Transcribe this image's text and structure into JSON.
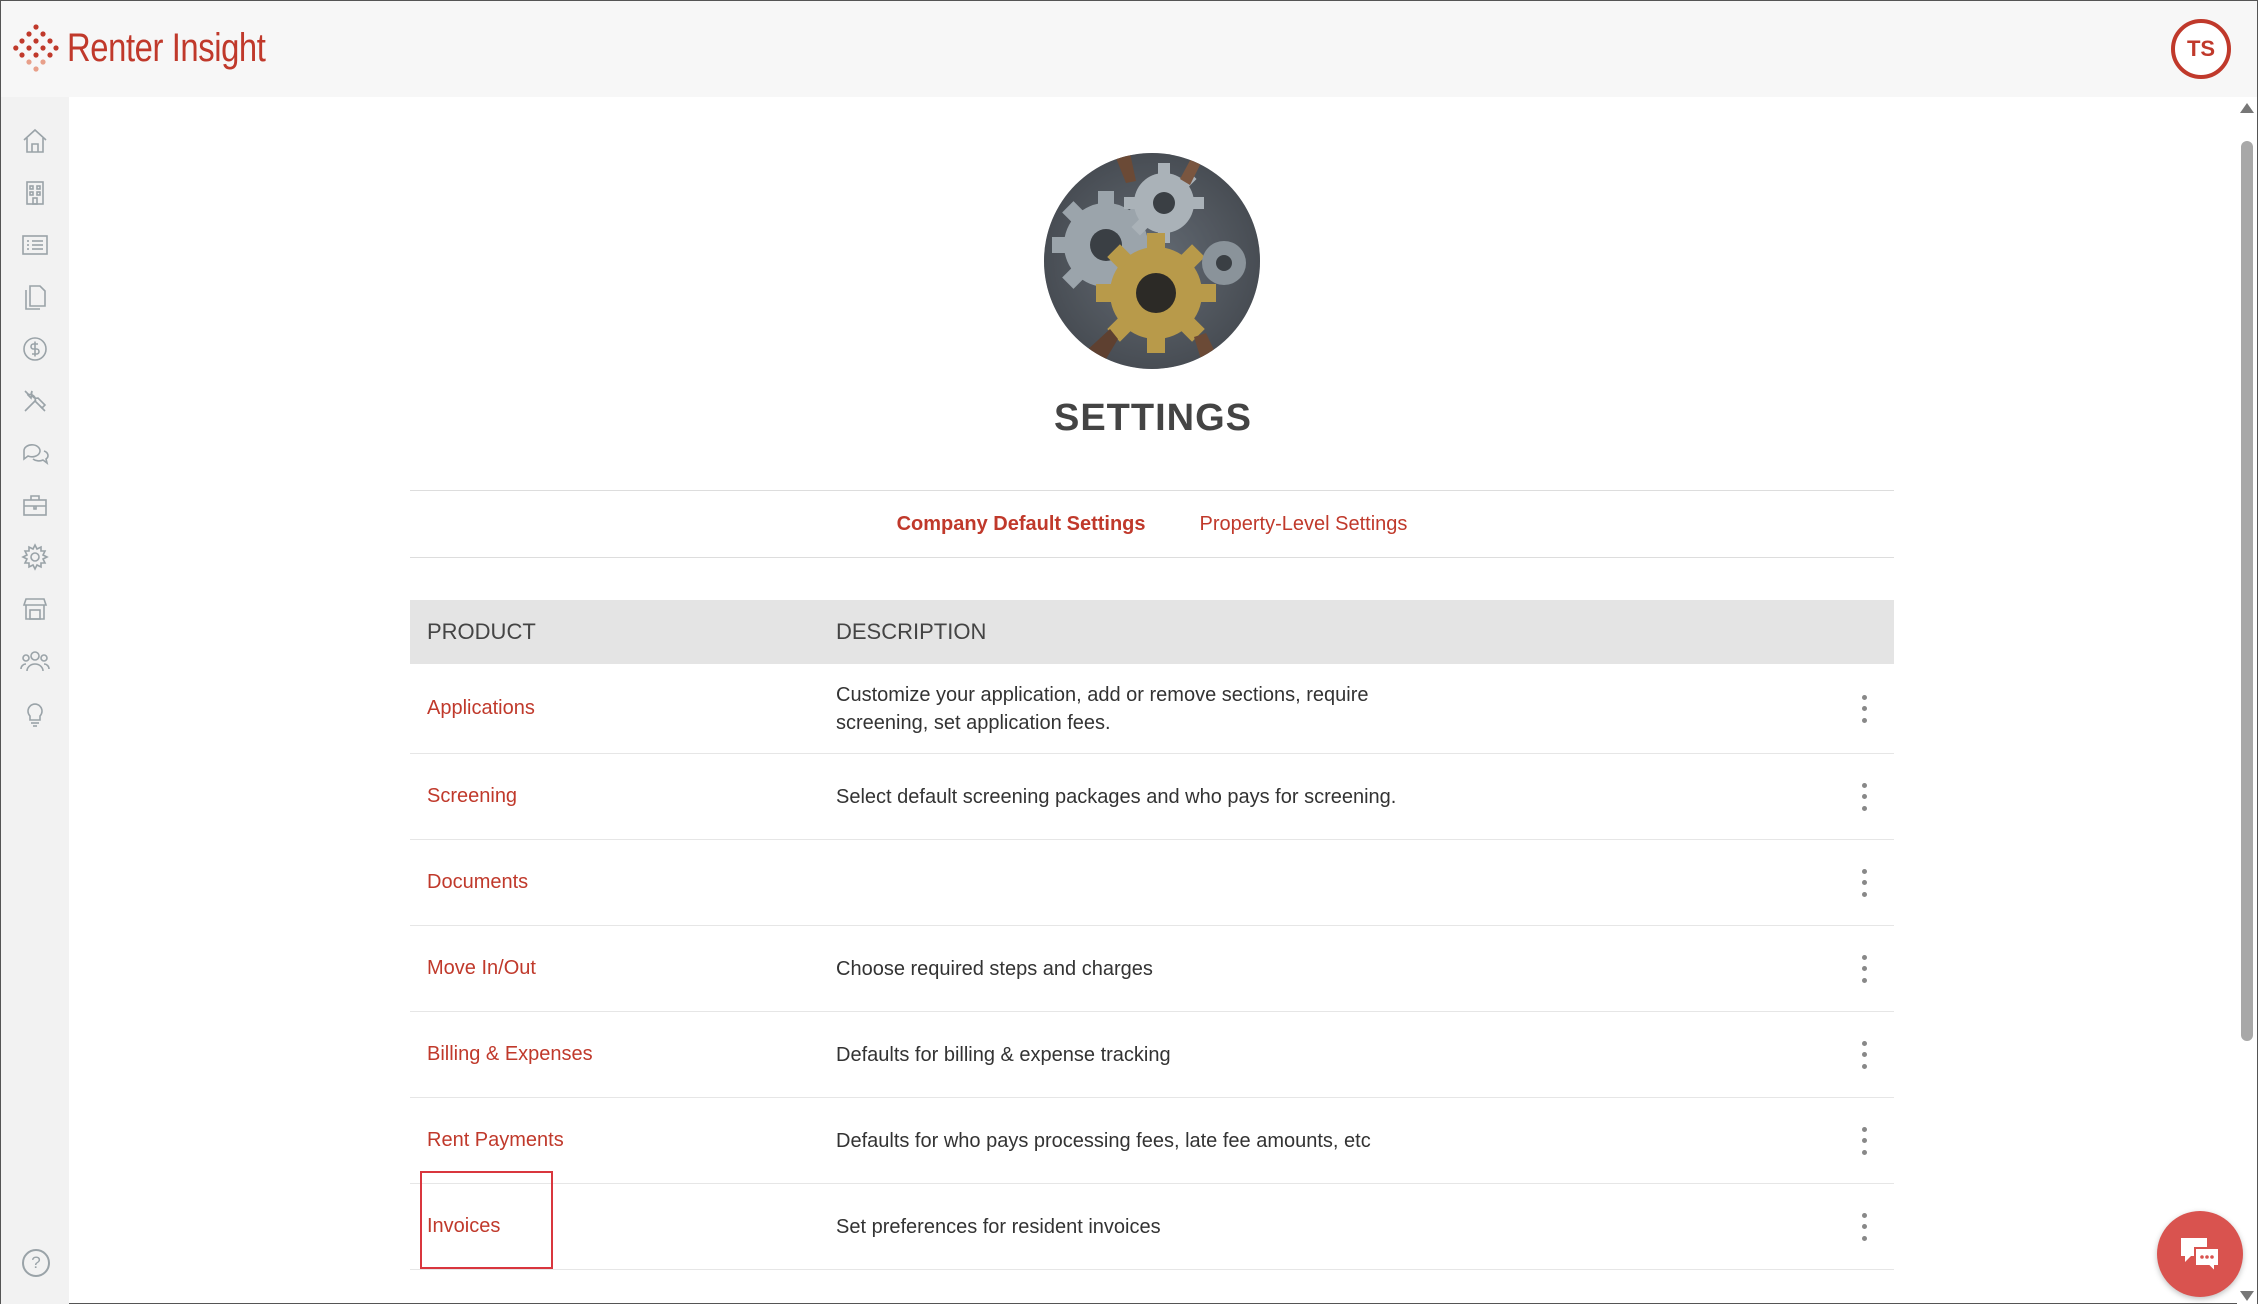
{
  "brand": {
    "name": "Renter Insight",
    "accent": "#c0392b"
  },
  "user": {
    "initials": "TS"
  },
  "sidebar": {
    "icons": [
      "home-icon",
      "building-icon",
      "list-icon",
      "documents-icon",
      "dollar-icon",
      "tools-icon",
      "chat-icon",
      "briefcase-icon",
      "gear-icon",
      "storefront-icon",
      "people-icon",
      "lightbulb-icon"
    ],
    "help": "?"
  },
  "page": {
    "title": "SETTINGS"
  },
  "tabs": [
    {
      "label": "Company Default Settings",
      "active": true
    },
    {
      "label": "Property-Level Settings",
      "active": false
    }
  ],
  "table": {
    "headers": {
      "product": "PRODUCT",
      "description": "DESCRIPTION"
    },
    "rows": [
      {
        "product": "Applications",
        "description": "Customize your application, add or remove sections, require screening, set application fees."
      },
      {
        "product": "Screening",
        "description": "Select default screening packages and who pays for screening."
      },
      {
        "product": "Documents",
        "description": ""
      },
      {
        "product": "Move In/Out",
        "description": "Choose required steps and charges"
      },
      {
        "product": "Billing & Expenses",
        "description": "Defaults for billing & expense tracking"
      },
      {
        "product": "Rent Payments",
        "description": "Defaults for who pays processing fees, late fee amounts, etc"
      },
      {
        "product": "Invoices",
        "description": "Set preferences for resident invoices"
      }
    ]
  }
}
